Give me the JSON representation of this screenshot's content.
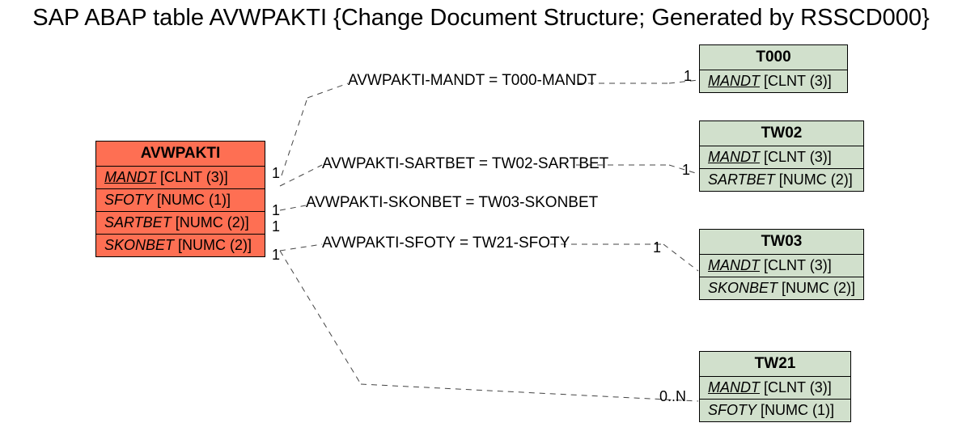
{
  "page_title": "SAP ABAP table AVWPAKTI {Change Document Structure; Generated by RSSCD000}",
  "main_entity": {
    "name": "AVWPAKTI",
    "fields": [
      {
        "name": "MANDT",
        "type": "[CLNT (3)]",
        "underline": true
      },
      {
        "name": "SFOTY",
        "type": "[NUMC (1)]",
        "underline": false
      },
      {
        "name": "SARTBET",
        "type": "[NUMC (2)]",
        "underline": false
      },
      {
        "name": "SKONBET",
        "type": "[NUMC (2)]",
        "underline": false
      }
    ]
  },
  "related": {
    "T000": {
      "name": "T000",
      "fields": [
        {
          "name": "MANDT",
          "type": "[CLNT (3)]",
          "underline": true
        }
      ]
    },
    "TW02": {
      "name": "TW02",
      "fields": [
        {
          "name": "MANDT",
          "type": "[CLNT (3)]",
          "underline": true
        },
        {
          "name": "SARTBET",
          "type": "[NUMC (2)]",
          "underline": false
        }
      ]
    },
    "TW03": {
      "name": "TW03",
      "fields": [
        {
          "name": "MANDT",
          "type": "[CLNT (3)]",
          "underline": true
        },
        {
          "name": "SKONBET",
          "type": "[NUMC (2)]",
          "underline": false
        }
      ]
    },
    "TW21": {
      "name": "TW21",
      "fields": [
        {
          "name": "MANDT",
          "type": "[CLNT (3)]",
          "underline": true
        },
        {
          "name": "SFOTY",
          "type": "[NUMC (1)]",
          "underline": false
        }
      ]
    }
  },
  "relations": {
    "r1": {
      "label": "AVWPAKTI-MANDT = T000-MANDT",
      "left_card": "1",
      "right_card": "1"
    },
    "r2": {
      "label": "AVWPAKTI-SARTBET = TW02-SARTBET",
      "left_card": "1",
      "right_card": "1"
    },
    "r3": {
      "label": "AVWPAKTI-SKONBET = TW03-SKONBET",
      "left_card": "1",
      "right_card": ""
    },
    "r4": {
      "label": "AVWPAKTI-SFOTY = TW21-SFOTY",
      "left_card": "1",
      "right_card": "1"
    },
    "r5": {
      "right_card": "0..N"
    }
  }
}
